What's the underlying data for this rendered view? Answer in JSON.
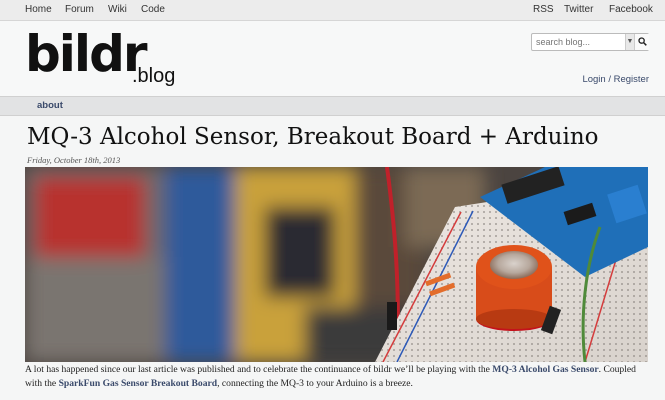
{
  "topnav": {
    "left": [
      "Home",
      "Forum",
      "Wiki",
      "Code"
    ],
    "right": [
      "RSS",
      "Twitter",
      "Facebook"
    ]
  },
  "logo": {
    "main": "bildr",
    "sub": ".blog"
  },
  "search": {
    "placeholder": "search blog..."
  },
  "auth": {
    "login": "Login",
    "separator": " / ",
    "register": "Register"
  },
  "subnav": {
    "about": "about"
  },
  "article": {
    "title": "MQ-3 Alcohol Sensor, Breakout Board + Arduino",
    "date": "Friday, October 18th, 2013",
    "intro_1": "A lot has happened since our last article was published and to celebrate the continuance of bildr we’ll be playing with the ",
    "link_1": "MQ-3 Alcohol Gas Sensor",
    "intro_2": ". Coupled with the ",
    "link_2": "SparkFun Gas Sensor Breakout Board",
    "intro_3": ", connecting the MQ-3 to your Arduino is a breeze."
  },
  "colors": {
    "link": "#3a4a6b",
    "arduino_blue": "#1f6fb8",
    "sensor_orange": "#e0521a"
  }
}
